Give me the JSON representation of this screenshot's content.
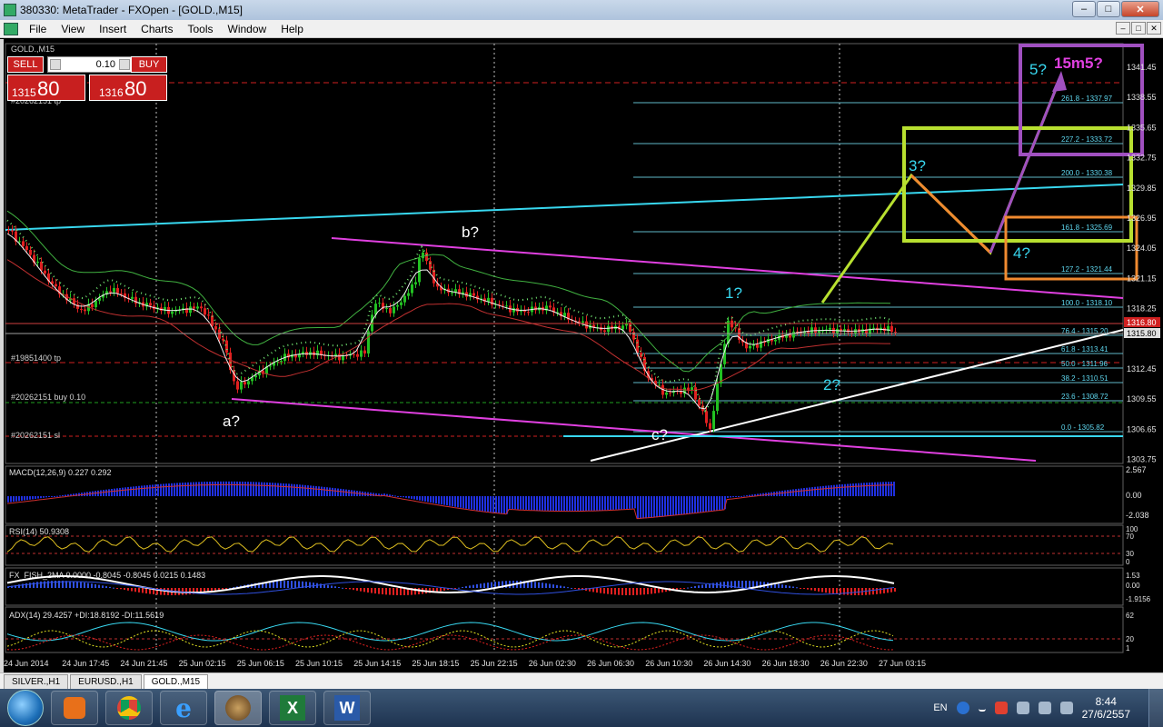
{
  "window": {
    "title": "380330: MetaTrader - FXOpen - [GOLD.,M15]",
    "buttons": {
      "minimize": "–",
      "maximize": "□",
      "close": "✕"
    }
  },
  "menu": [
    "File",
    "View",
    "Insert",
    "Charts",
    "Tools",
    "Window",
    "Help"
  ],
  "chart": {
    "symbol_label": "GOLD.,M15",
    "trade_panel": {
      "sell_label": "SELL",
      "buy_label": "BUY",
      "lot": "0.10",
      "sell_price_small": "1315",
      "sell_price_big": "80",
      "buy_price_small": "1316",
      "buy_price_big": "80"
    },
    "price_axis": [
      "1341.45",
      "1338.55",
      "1335.65",
      "1332.75",
      "1329.85",
      "1326.95",
      "1324.05",
      "1321.15",
      "1318.25",
      "1315.80",
      "1312.45",
      "1309.55",
      "1306.65",
      "1303.75"
    ],
    "price_tags": {
      "ask": "1316.80",
      "bid": "1315.80"
    },
    "fib_levels": [
      "261.8 - 1337.97",
      "227.2 - 1333.72",
      "200.0 - 1330.38",
      "161.8 - 1325.69",
      "127.2 - 1321.44",
      "100.0 - 1318.10",
      "76.4 - 1315.20",
      "61.8 - 1313.41",
      "50.0 - 1311.96",
      "38.2 - 1310.51",
      "23.6 - 1308.72",
      "0.0 - 1305.82"
    ],
    "order_labels": [
      "#20262151 tp",
      "#19851400 tp",
      "#20262151 buy 0.10",
      "#20262151 sl"
    ],
    "wave_labels": {
      "a": "a?",
      "b": "b?",
      "c": "c?",
      "w1": "1?",
      "w2": "2?",
      "w3": "3?",
      "w4": "4?",
      "w5": "5?",
      "w5b": "15m5?"
    },
    "time_axis": [
      "24 Jun 2014",
      "24 Jun 17:45",
      "24 Jun 21:45",
      "25 Jun 02:15",
      "25 Jun 06:15",
      "25 Jun 10:15",
      "25 Jun 14:15",
      "25 Jun 18:15",
      "25 Jun 22:15",
      "26 Jun 02:30",
      "26 Jun 06:30",
      "26 Jun 10:30",
      "26 Jun 14:30",
      "26 Jun 18:30",
      "26 Jun 22:30",
      "27 Jun 03:15"
    ],
    "indicators": {
      "macd": {
        "label": "MACD(12,26,9) 0.227 0.292",
        "axis": [
          "2.567",
          "0.00",
          "-2.038"
        ]
      },
      "rsi": {
        "label": "RSI(14) 50.9308",
        "axis": [
          "100",
          "70",
          "30",
          "0"
        ]
      },
      "fish": {
        "label": "FX_FISH_2MA 0.0000 -0.8045 -0.8045 0.0215 0.1483",
        "axis": [
          "1.53",
          "0.00",
          "-1.9156"
        ]
      },
      "adx": {
        "label": "ADX(14) 29.4257 +DI:18.8192 -DI:11.5619",
        "axis": [
          "62",
          "20",
          "1"
        ]
      }
    },
    "colors": {
      "bull": "#22c022",
      "bear": "#e02020",
      "aqua": "#38d8f0",
      "magenta": "#e040e0",
      "lime": "#b8e030",
      "orange": "#f08a30",
      "purple": "#a050c0"
    }
  },
  "tabs": [
    "SILVER.,H1",
    "EURUSD.,H1",
    "GOLD.,M15"
  ],
  "taskbar": {
    "apps": [
      "media-player",
      "chrome",
      "internet-explorer",
      "metatrader",
      "excel",
      "word"
    ],
    "excel_letter": "X",
    "word_letter": "W",
    "lang": "EN",
    "time": "8:44",
    "date": "27/6/2557"
  }
}
